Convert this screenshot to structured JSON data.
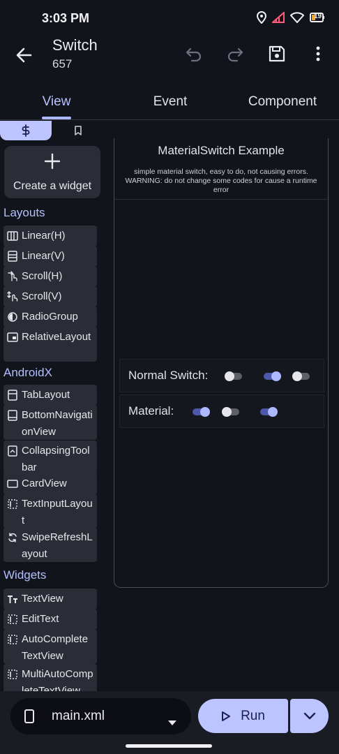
{
  "status_bar": {
    "time": "3:03 PM",
    "battery": "19"
  },
  "app_bar": {
    "title": "Switch",
    "subtitle": "657"
  },
  "tabs": [
    {
      "label": "View"
    },
    {
      "label": "Event"
    },
    {
      "label": "Component"
    }
  ],
  "palette": {
    "create_widget_label": "Create a widget",
    "sections": {
      "layouts": "Layouts",
      "androidx": "AndroidX",
      "widgets": "Widgets"
    },
    "layouts": [
      "Linear(H)",
      "Linear(V)",
      "Scroll(H)",
      "Scroll(V)",
      "RadioGroup",
      "RelativeLayout"
    ],
    "androidx": [
      "TabLayout",
      "BottomNavigationView",
      "CollapsingToolbar",
      "CardView",
      "TextInputLayout",
      "SwipeRefreshLayout"
    ],
    "widgets": [
      "TextView",
      "EditText",
      "AutoCompleteTextView",
      "MultiAutoCompleteTextView"
    ]
  },
  "preview": {
    "title": "MaterialSwitch Example",
    "description_line1": "simple material switch, easy to do, not causing errors.",
    "description_line2": "WARNING: do not change some codes for cause a runtime error",
    "rows": [
      {
        "label": "Normal Switch:",
        "switches": [
          false,
          true,
          false
        ]
      },
      {
        "label": "Material:",
        "switches": [
          true,
          false,
          true
        ]
      }
    ]
  },
  "bottom_bar": {
    "file_name": "main.xml",
    "run_label": "Run"
  },
  "colors": {
    "accent": "#bcc5ff",
    "switch_on": "#aeb8ff",
    "switch_off": "#e5e5ea"
  }
}
